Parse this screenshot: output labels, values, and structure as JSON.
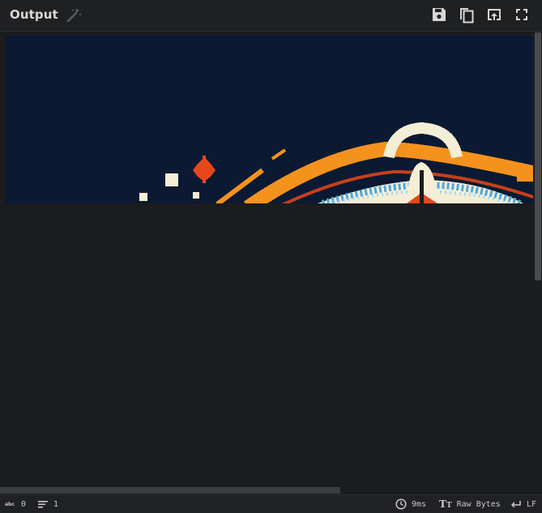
{
  "header": {
    "title": "Output",
    "icons": {
      "magic": "magic-wand-icon",
      "save": "save-icon",
      "copy": "copy-icon",
      "replace_input": "replace-input-icon",
      "maximise": "maximise-icon"
    }
  },
  "status": {
    "char_count_label": "abc",
    "char_count": "0",
    "line_count": "1",
    "time": "9ms",
    "encoding": "Raw Bytes",
    "eol": "LF"
  },
  "colors": {
    "bg": "#1b1c1e",
    "header_bg": "#1f2022",
    "image_bg": "#0b1a32",
    "orange": "#f5921e",
    "red": "#e8471c",
    "cream": "#f4eed6",
    "blue": "#4ea8dc"
  }
}
